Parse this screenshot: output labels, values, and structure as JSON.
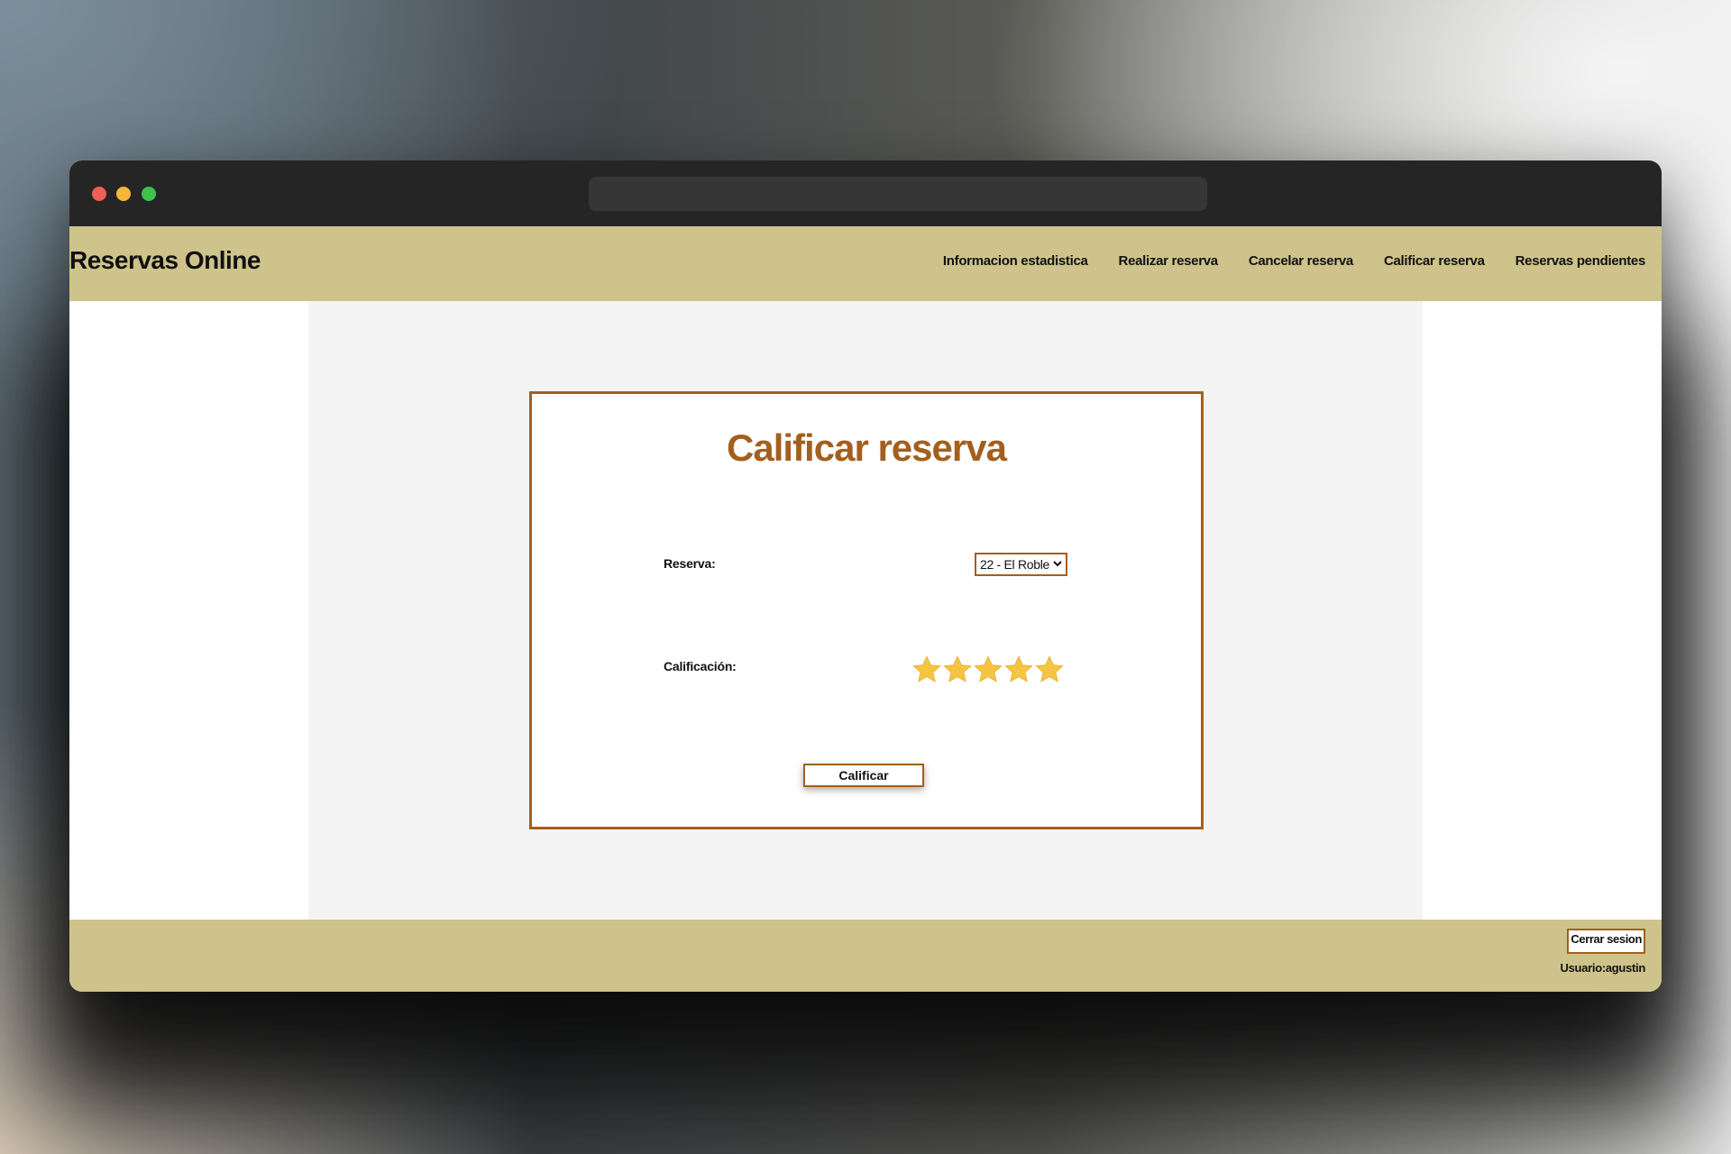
{
  "app": {
    "brand": "Reservas Online"
  },
  "nav": {
    "links": [
      {
        "label": "Informacion estadistica"
      },
      {
        "label": "Realizar reserva"
      },
      {
        "label": "Cancelar reserva"
      },
      {
        "label": "Calificar reserva"
      },
      {
        "label": "Reservas pendientes"
      }
    ]
  },
  "form": {
    "title": "Calificar reserva",
    "reserva_label": "Reserva:",
    "reserva_selected": "22 - El Roble",
    "calificacion_label": "Calificación:",
    "rating_value": 5,
    "rating_max": 5,
    "submit_label": "Calificar"
  },
  "footer": {
    "logout_label": "Cerrar sesion",
    "user_label": "Usuario:agustin"
  },
  "colors": {
    "accent": "#a35f1f",
    "header_bg": "#cec38b",
    "star": "#f5c542"
  },
  "icons": {
    "star": "star-icon",
    "select_arrow": "chevron-down-icon"
  }
}
